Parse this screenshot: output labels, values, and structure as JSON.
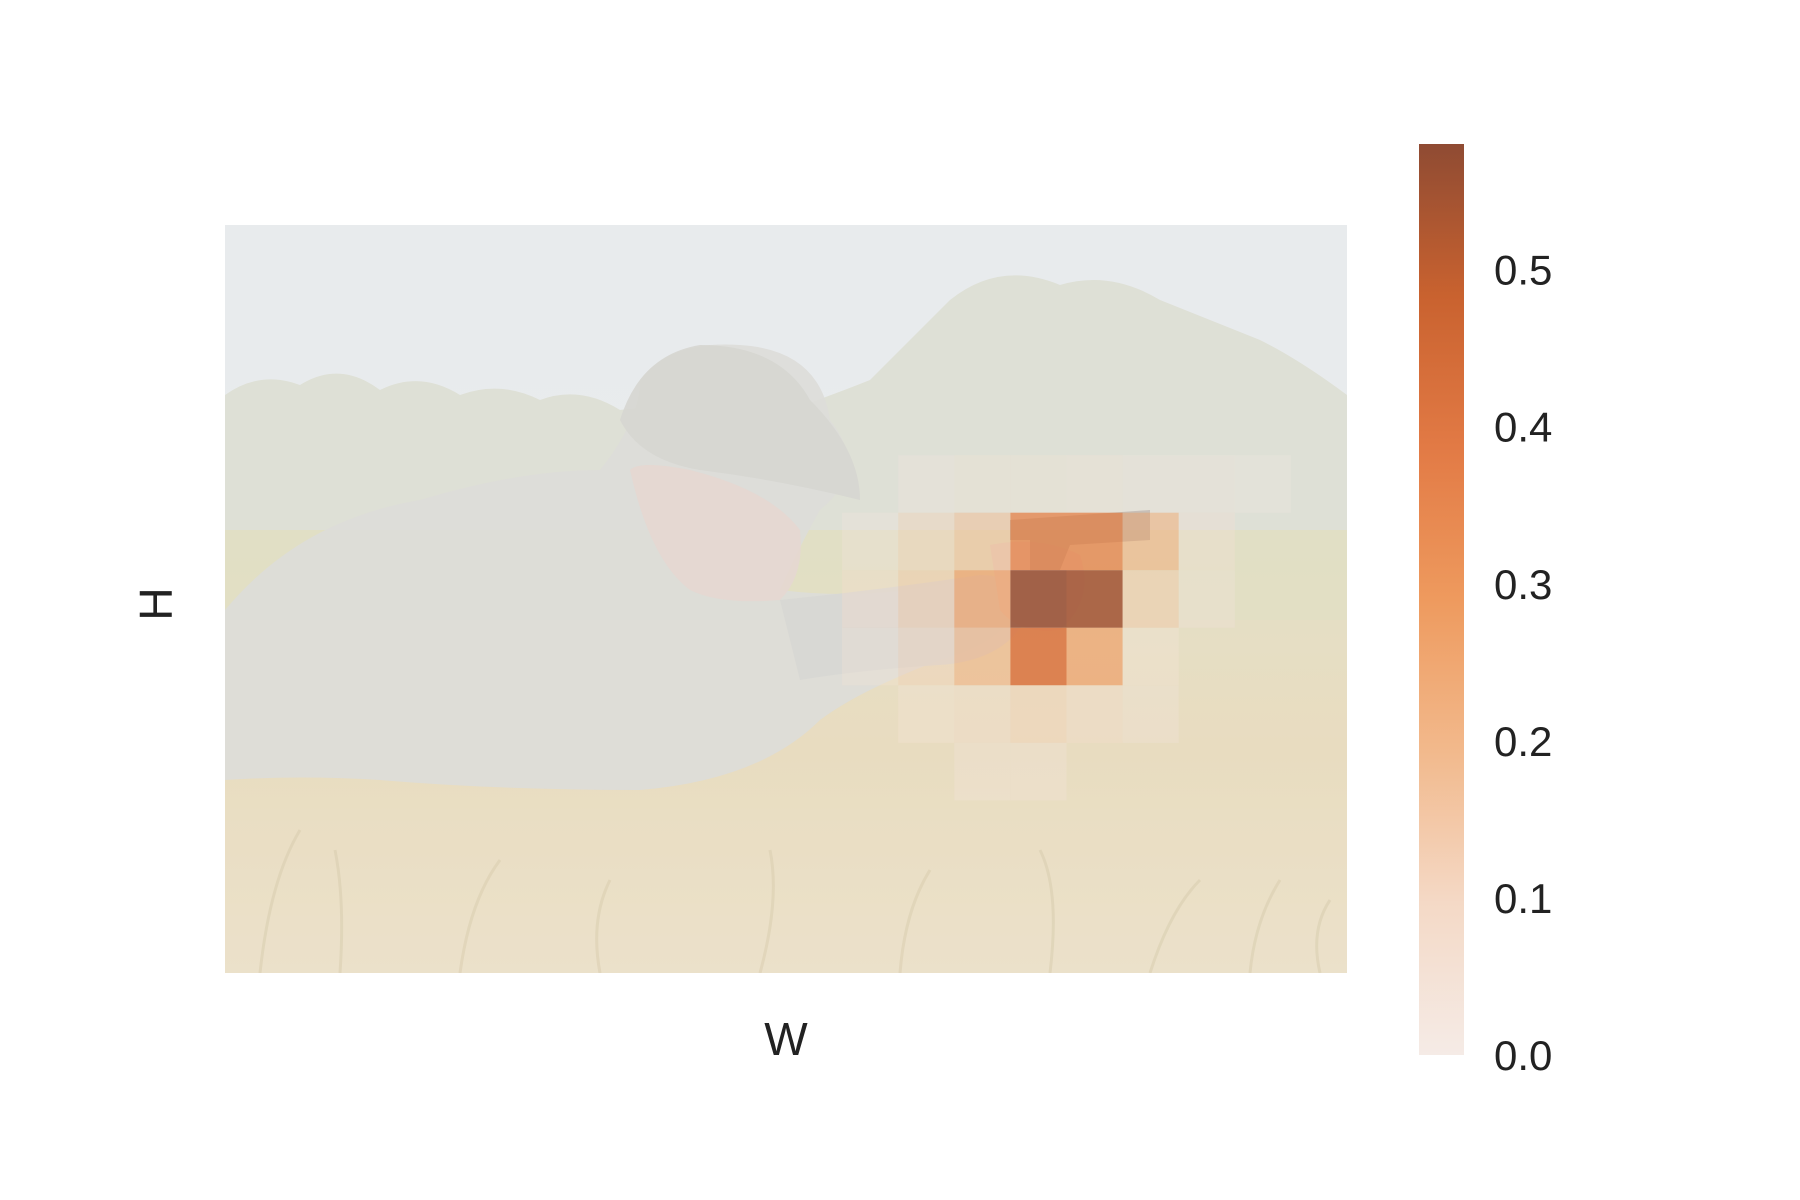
{
  "chart_data": {
    "type": "heatmap",
    "title": "",
    "xlabel": "W",
    "ylabel": "H",
    "background": "photo of a soldier in camouflage lying prone in dry grass, aiming a pistol, trees and sky behind",
    "grid": false,
    "colormap": {
      "name": "Oranges",
      "stops": [
        "#f5ebe6",
        "#f4d9c6",
        "#f2b98c",
        "#ee9a5e",
        "#e27a45",
        "#c9622f",
        "#8f4b33"
      ],
      "range": [
        0,
        0.58
      ],
      "ticks": [
        0.0,
        0.1,
        0.2,
        0.3,
        0.4,
        0.5
      ],
      "tick_labels": [
        "0.0",
        "0.1",
        "0.2",
        "0.3",
        "0.4",
        "0.5"
      ]
    },
    "grid_shape": [
      13,
      20
    ],
    "cells": [
      {
        "row": 4,
        "col": 12,
        "value": 0.03
      },
      {
        "row": 4,
        "col": 13,
        "value": 0.05
      },
      {
        "row": 4,
        "col": 14,
        "value": 0.05
      },
      {
        "row": 4,
        "col": 15,
        "value": 0.04
      },
      {
        "row": 4,
        "col": 16,
        "value": 0.02
      },
      {
        "row": 4,
        "col": 17,
        "value": 0.02
      },
      {
        "row": 4,
        "col": 18,
        "value": 0.01
      },
      {
        "row": 5,
        "col": 11,
        "value": 0.03
      },
      {
        "row": 5,
        "col": 12,
        "value": 0.12
      },
      {
        "row": 5,
        "col": 13,
        "value": 0.18
      },
      {
        "row": 5,
        "col": 14,
        "value": 0.36
      },
      {
        "row": 5,
        "col": 15,
        "value": 0.36
      },
      {
        "row": 5,
        "col": 16,
        "value": 0.22
      },
      {
        "row": 5,
        "col": 17,
        "value": 0.06
      },
      {
        "row": 6,
        "col": 11,
        "value": 0.08
      },
      {
        "row": 6,
        "col": 12,
        "value": 0.15
      },
      {
        "row": 6,
        "col": 13,
        "value": 0.28
      },
      {
        "row": 6,
        "col": 14,
        "value": 0.57
      },
      {
        "row": 6,
        "col": 15,
        "value": 0.55
      },
      {
        "row": 6,
        "col": 16,
        "value": 0.15
      },
      {
        "row": 6,
        "col": 17,
        "value": 0.03
      },
      {
        "row": 7,
        "col": 11,
        "value": 0.05
      },
      {
        "row": 7,
        "col": 12,
        "value": 0.12
      },
      {
        "row": 7,
        "col": 13,
        "value": 0.22
      },
      {
        "row": 7,
        "col": 14,
        "value": 0.42
      },
      {
        "row": 7,
        "col": 15,
        "value": 0.28
      },
      {
        "row": 7,
        "col": 16,
        "value": 0.04
      },
      {
        "row": 8,
        "col": 12,
        "value": 0.04
      },
      {
        "row": 8,
        "col": 13,
        "value": 0.07
      },
      {
        "row": 8,
        "col": 14,
        "value": 0.12
      },
      {
        "row": 8,
        "col": 15,
        "value": 0.08
      },
      {
        "row": 8,
        "col": 16,
        "value": 0.02
      },
      {
        "row": 9,
        "col": 13,
        "value": 0.02
      },
      {
        "row": 9,
        "col": 14,
        "value": 0.03
      }
    ]
  }
}
